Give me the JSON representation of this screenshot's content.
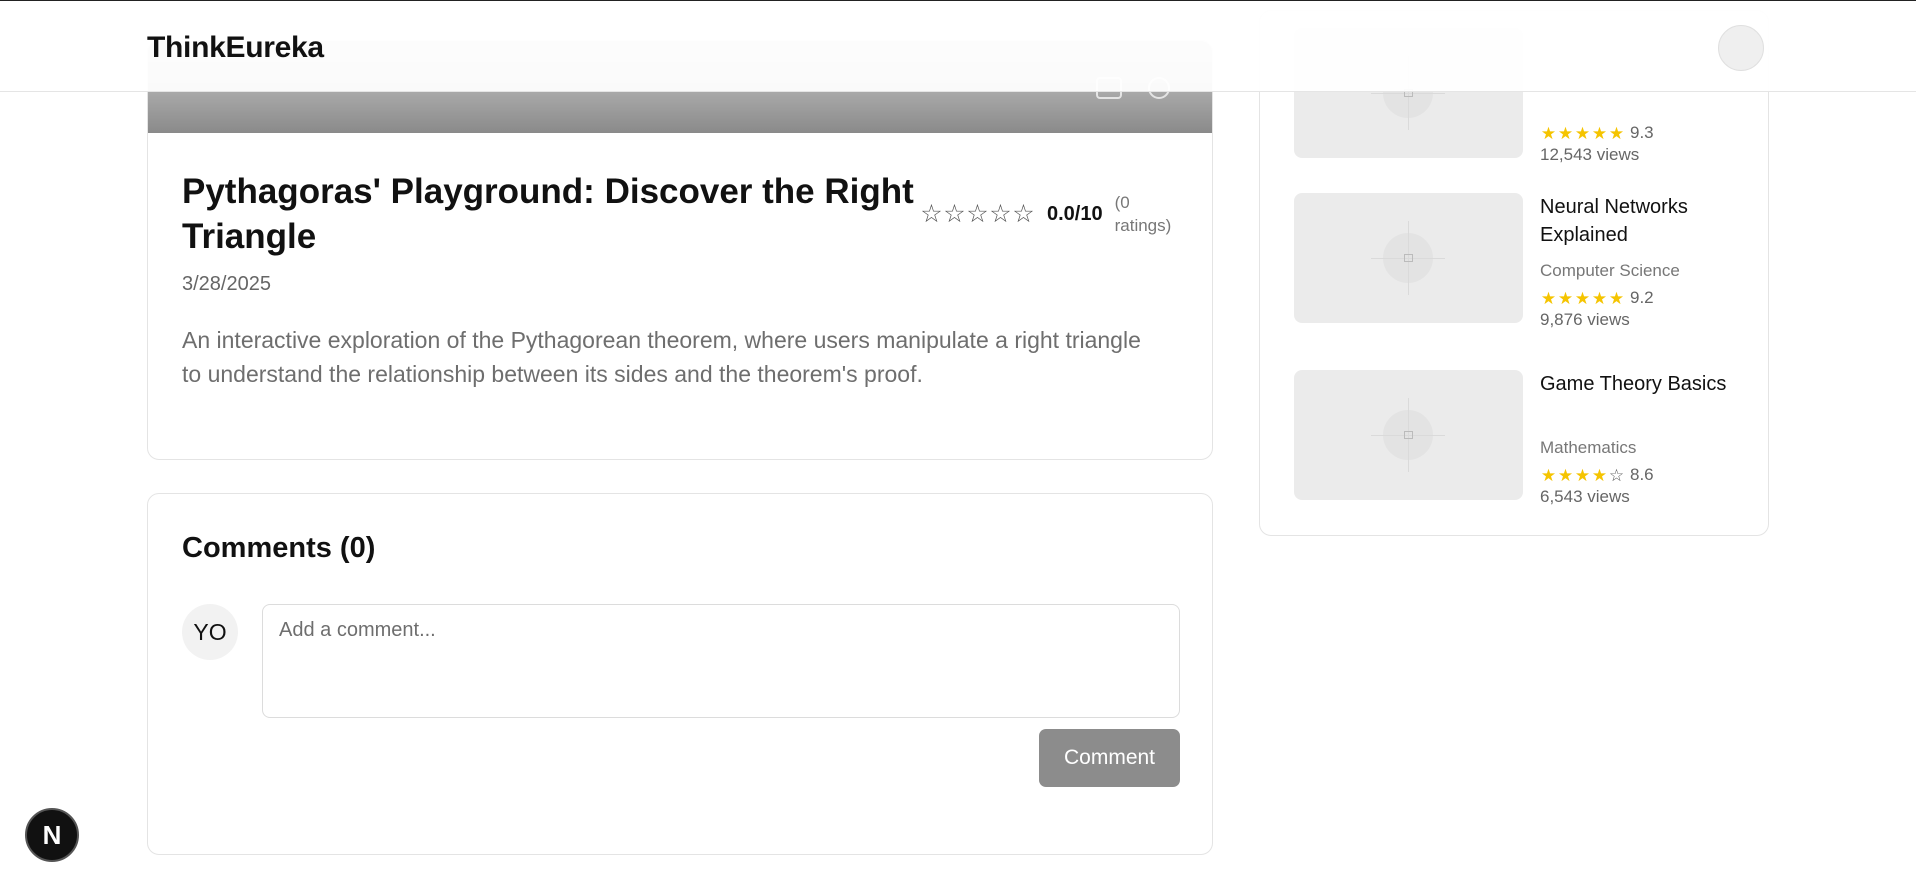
{
  "header": {
    "brand": "ThinkEureka"
  },
  "article": {
    "title": "Pythagoras' Playground: Discover the Right Triangle",
    "rating_score": "0.0/10",
    "rating_count": "(0 ratings)",
    "stars_filled": 0,
    "stars_total": 5,
    "date": "3/28/2025",
    "description": "An interactive exploration of the Pythagorean theorem, where users manipulate a right triangle to understand the relationship between its sides and the theorem's proof."
  },
  "comments": {
    "title": "Comments (0)",
    "avatar_initials": "YO",
    "input_placeholder": "Add a comment...",
    "submit_label": "Comment"
  },
  "related": {
    "items": [
      {
        "title": "",
        "category": "",
        "score": "9.3",
        "stars_filled": 5,
        "views": "12,543 views"
      },
      {
        "title": "Neural Networks Explained",
        "category": "Computer Science",
        "score": "9.2",
        "stars_filled": 5,
        "views": "9,876 views"
      },
      {
        "title": "Game Theory Basics",
        "category": "Mathematics",
        "score": "8.6",
        "stars_filled": 4,
        "views": "6,543 views"
      }
    ]
  },
  "dev_badge": {
    "letter": "N"
  },
  "colors": {
    "star_on": "#f5c400",
    "button_disabled": "#8c8c8c"
  }
}
